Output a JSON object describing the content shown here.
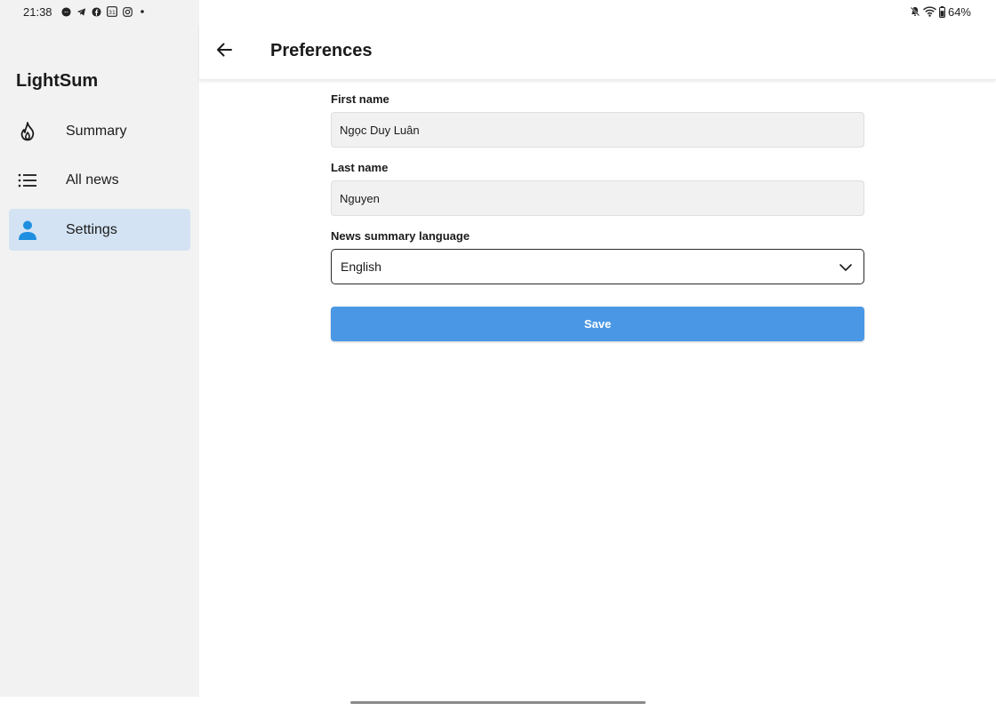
{
  "status_bar": {
    "time": "21:38",
    "notification_icons": [
      "messenger-icon",
      "telegram-icon",
      "facebook-icon",
      "calendar-icon",
      "instagram-icon",
      "dot-icon"
    ],
    "calendar_day": "31",
    "battery": "64%"
  },
  "sidebar": {
    "app_title": "LightSum",
    "items": [
      {
        "label": "Summary",
        "icon": "flame-icon",
        "active": false
      },
      {
        "label": "All news",
        "icon": "list-icon",
        "active": false
      },
      {
        "label": "Settings",
        "icon": "person-icon",
        "active": true
      }
    ]
  },
  "header": {
    "title": "Preferences"
  },
  "form": {
    "first_name_label": "First name",
    "first_name_value": "Ngọc Duy Luân",
    "last_name_label": "Last name",
    "last_name_value": "Nguyen",
    "language_label": "News summary language",
    "language_value": "English",
    "save_label": "Save"
  },
  "colors": {
    "sidebar_bg": "#f2f2f2",
    "active_item_bg": "#d3e3f3",
    "accent": "#4a98e5",
    "person_icon": "#1e8fe0"
  }
}
